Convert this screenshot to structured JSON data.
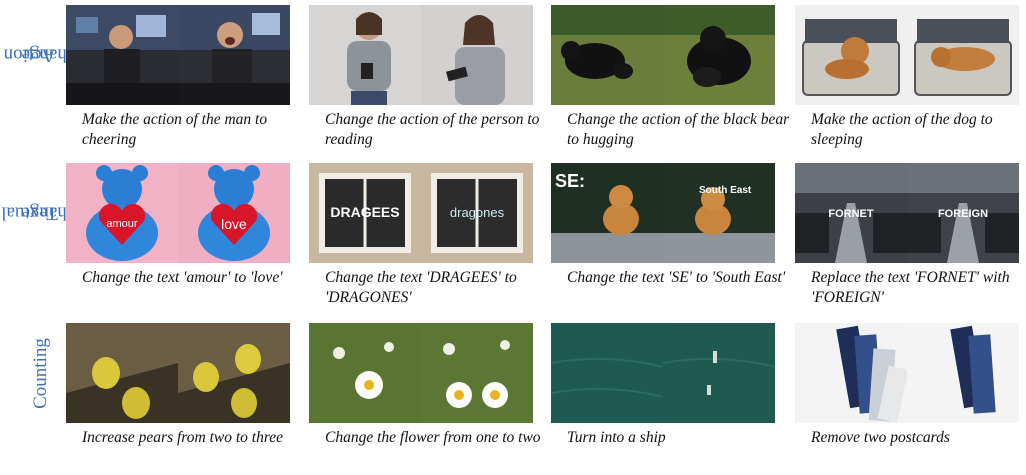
{
  "rows": [
    {
      "label_line1": "Action",
      "label_line2": "Change",
      "captions": [
        "Make the action of the man to cheering",
        "Change the action of the person to reading",
        "Change the action of the black bear to hugging",
        "Make the action of the dog to sleeping"
      ]
    },
    {
      "label_line1": "Textual",
      "label_line2": "Change",
      "captions": [
        "Change the text 'amour' to 'love'",
        "Change the text 'DRAGEES' to 'DRAGONES'",
        "Change the text 'SE' to 'South East'",
        "Replace the text 'FORNET' with 'FOREIGN'"
      ]
    },
    {
      "label_line1": "Counting",
      "label_line2": "",
      "captions": [
        "Increase pears from two to three",
        "Change the flower from one to two",
        "Turn into a ship",
        "Remove two postcards"
      ]
    }
  ],
  "image_text": {
    "amour": "amour",
    "love": "love",
    "dragees": "DRAGEES",
    "dragones": "dragones",
    "se": "SE:",
    "south_east": "South East",
    "fornet": "FORNET",
    "foreign": "FOREIGN"
  }
}
